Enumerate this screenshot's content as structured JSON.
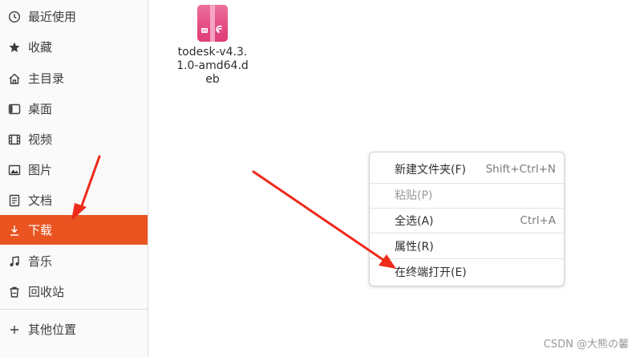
{
  "sidebar": {
    "items": [
      {
        "label": "最近使用",
        "icon": "clock-icon"
      },
      {
        "label": "收藏",
        "icon": "star-icon"
      },
      {
        "label": "主目录",
        "icon": "home-icon"
      },
      {
        "label": "桌面",
        "icon": "desktop-icon"
      },
      {
        "label": "视频",
        "icon": "film-icon"
      },
      {
        "label": "图片",
        "icon": "image-icon"
      },
      {
        "label": "文档",
        "icon": "document-icon"
      },
      {
        "label": "下载",
        "icon": "download-icon",
        "active": true
      },
      {
        "label": "音乐",
        "icon": "music-icon"
      },
      {
        "label": "回收站",
        "icon": "trash-icon"
      }
    ],
    "other": {
      "label": "其他位置",
      "icon": "plus-icon"
    }
  },
  "file": {
    "name": "todesk-v4.3.1.0-amd64.deb",
    "icon": "deb-package-icon"
  },
  "context_menu": {
    "items": [
      {
        "label": "新建文件夹(F)",
        "accel": "Shift+Ctrl+N",
        "enabled": true
      },
      {
        "label": "粘贴(P)",
        "accel": "",
        "enabled": false
      },
      {
        "label": "全选(A)",
        "accel": "Ctrl+A",
        "enabled": true
      },
      {
        "label": "属性(R)",
        "accel": "",
        "enabled": true
      },
      {
        "label": "在终端打开(E)",
        "accel": "",
        "enabled": true
      }
    ]
  },
  "watermark": "CSDN @大熊の馨",
  "colors": {
    "accent": "#e95420",
    "arrow": "#ee2a1b",
    "package": "#e4437d"
  }
}
